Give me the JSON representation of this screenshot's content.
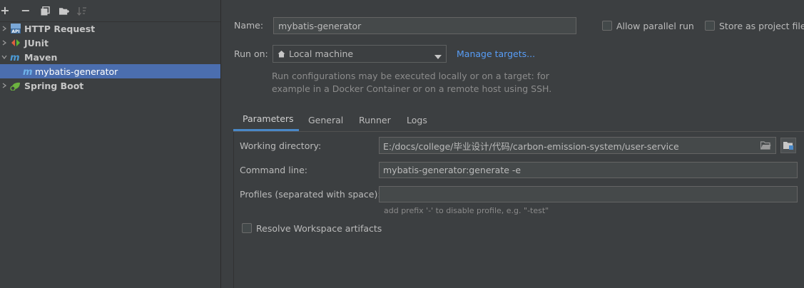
{
  "toolbar": {
    "add": "+",
    "remove": "−"
  },
  "tree": {
    "items": [
      {
        "label": "HTTP Request"
      },
      {
        "label": "JUnit"
      },
      {
        "label": "Maven"
      },
      {
        "label": "mybatis-generator"
      },
      {
        "label": "Spring Boot"
      }
    ]
  },
  "form": {
    "name_label": "Name:",
    "name_value": "mybatis-generator",
    "allow_parallel_label": "Allow parallel run",
    "store_project_label": "Store as project file",
    "run_on_label": "Run on:",
    "run_on_value": "Local machine",
    "manage_targets": "Manage targets...",
    "run_on_hint_1": "Run configurations may be executed locally or on a target: for",
    "run_on_hint_2": "example in a Docker Container or on a remote host using SSH."
  },
  "tabs": [
    {
      "label": "Parameters"
    },
    {
      "label": "General"
    },
    {
      "label": "Runner"
    },
    {
      "label": "Logs"
    }
  ],
  "parameters": {
    "working_dir_label": "Working directory:",
    "working_dir_value": "E:/docs/college/毕业设计/代码/carbon-emission-system/user-service",
    "command_line_label": "Command line:",
    "command_line_value": "mybatis-generator:generate -e",
    "profiles_label": "Profiles (separated with space):",
    "profiles_value": "",
    "profiles_hint": "add prefix '-' to disable profile, e.g. \"-test\"",
    "resolve_label": "Resolve Workspace artifacts"
  },
  "colors": {
    "background": "#3c3f41",
    "selection": "#4b6eaf",
    "link": "#589df6",
    "tab_underline": "#4a88c7"
  }
}
